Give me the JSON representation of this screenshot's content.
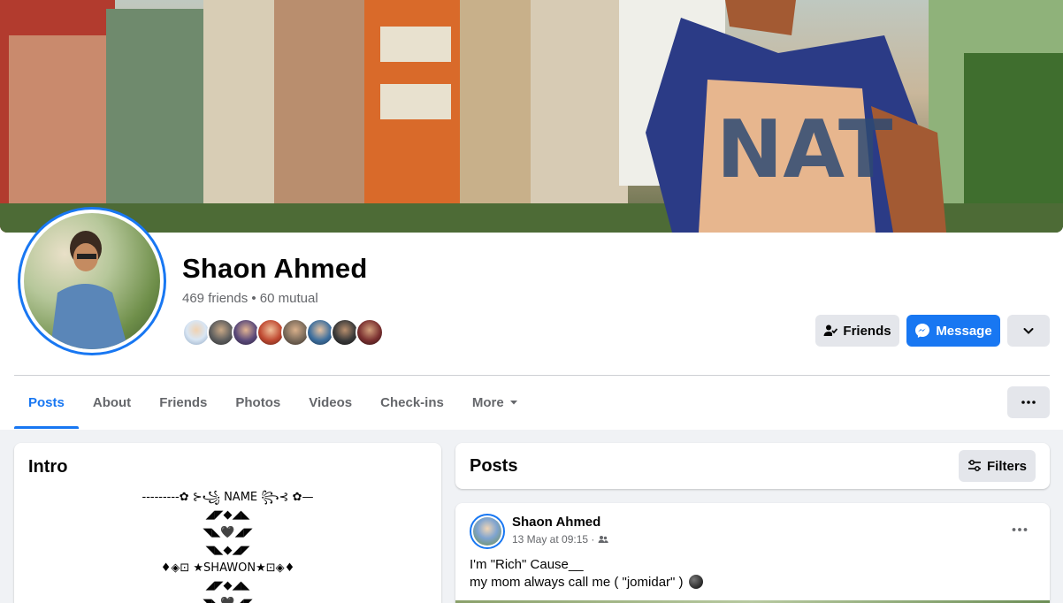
{
  "profile": {
    "name": "Shaon Ahmed",
    "friend_summary": "469 friends • 60 mutual",
    "mutual_faces": [
      "face-1",
      "face-2",
      "face-3",
      "face-4",
      "face-5",
      "face-6",
      "face-7",
      "face-8"
    ]
  },
  "actions": {
    "friends_label": "Friends",
    "message_label": "Message"
  },
  "tabs": [
    {
      "label": "Posts",
      "active": true
    },
    {
      "label": "About"
    },
    {
      "label": "Friends"
    },
    {
      "label": "Photos"
    },
    {
      "label": "Videos"
    },
    {
      "label": "Check-ins"
    },
    {
      "label": "More"
    }
  ],
  "intro": {
    "title": "Intro",
    "bio": "---------✿ ⊱꧁ NAME ꧂⊰ ✿—\n◢◤◆◢◣\n◥◣🖤◢◤\n◥◣◆◢◤\n♦◈⊡ ★SHAWON★⊡◈♦\n◢◤◆◢◣\n◥◣🖤◢◤"
  },
  "posts_section": {
    "title": "Posts",
    "filters_label": "Filters"
  },
  "post": {
    "author": "Shaon Ahmed",
    "timestamp": "13 May at 09:15 ·",
    "text_line_1": "I'm \"Rich\" Cause__",
    "text_line_2": "my mom always call me ( \"jomidar\" )"
  },
  "colors": {
    "accent": "#1877f2",
    "secondary_button": "#e4e6eb",
    "page_bg": "#f0f2f5"
  }
}
